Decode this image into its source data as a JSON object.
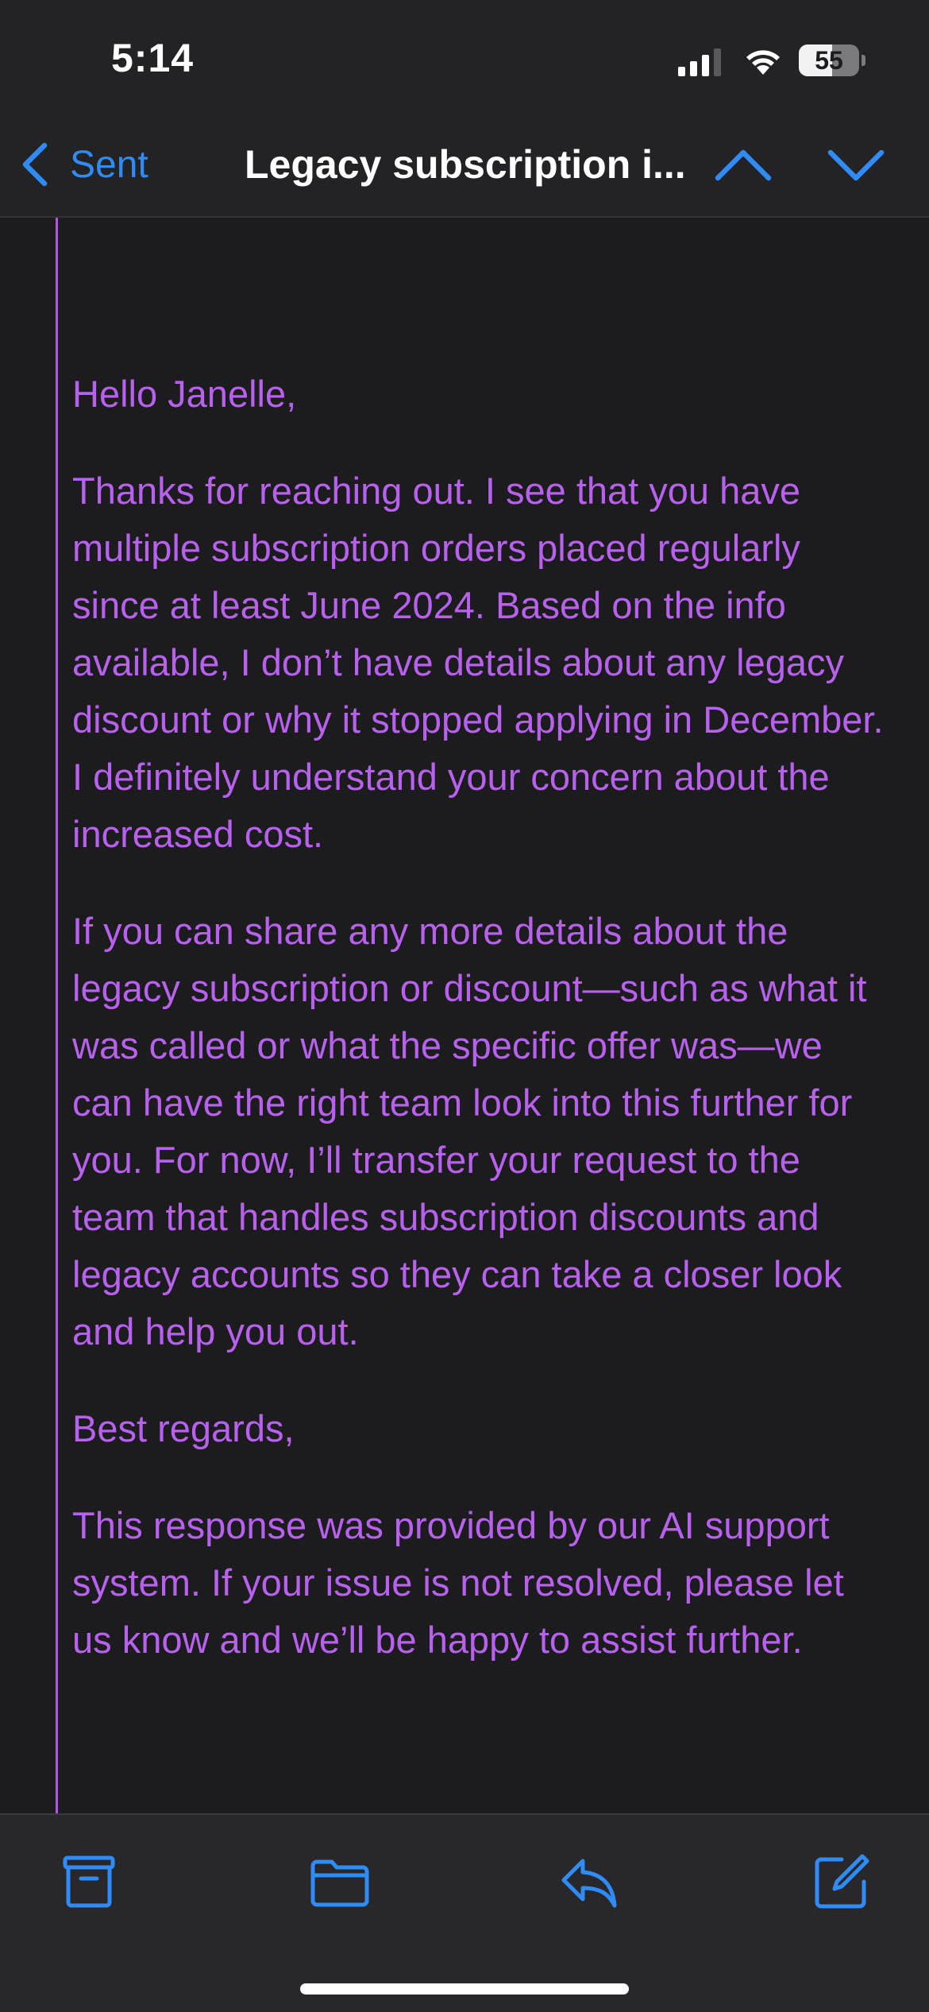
{
  "status_bar": {
    "time": "5:14",
    "battery_level": "55",
    "battery_fraction": 0.55
  },
  "nav": {
    "back_label": "Sent",
    "title": "Legacy subscription i..."
  },
  "message": {
    "paragraphs": [
      "Hello Janelle,",
      "Thanks for reaching out. I see that you have multiple subscription orders placed regularly since at least June 2024. Based on the info available, I don’t have details about any legacy discount or why it stopped applying in December. I definitely understand your concern about the increased cost.",
      "If you can share any more details about the legacy subscription or discount—such as what it was called or what the specific offer was—we can have the right team look into this further for you. For now, I’ll transfer your request to the team that handles subscription discounts and legacy accounts so they can take a closer look and help you out.",
      "Best regards,",
      "This response was provided by our AI support system. If your issue is not resolved, please let us know and we’ll be happy to assist further."
    ]
  },
  "toolbar": {
    "icons": [
      "archive-icon",
      "folder-icon",
      "reply-icon",
      "compose-icon"
    ]
  },
  "colors": {
    "accent_blue": "#2f8cf7",
    "quote_purple": "#b861ee",
    "background": "#1c1c1e",
    "bar_background": "#232325"
  }
}
